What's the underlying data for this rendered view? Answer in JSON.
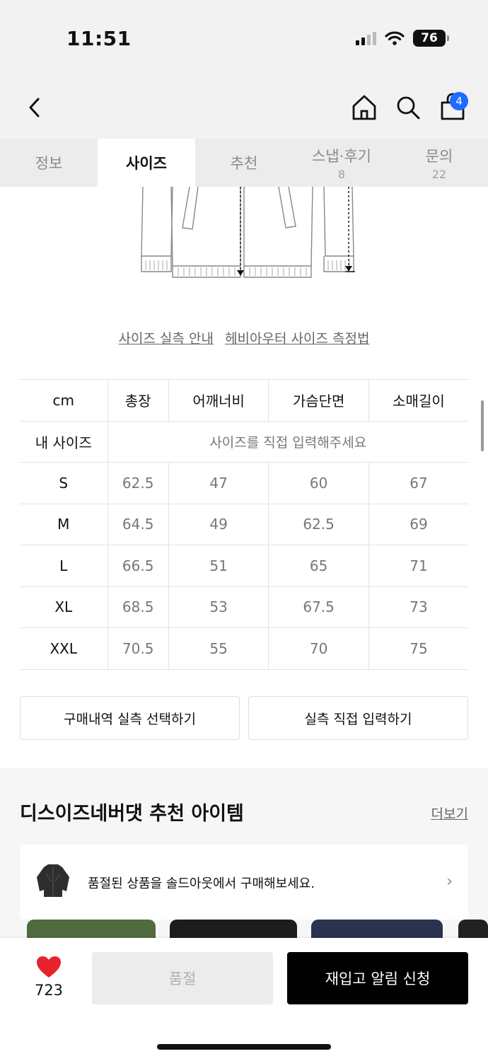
{
  "status": {
    "time": "11:51",
    "battery": "76"
  },
  "nav": {
    "cart_count": "4"
  },
  "tabs": [
    {
      "label": "정보",
      "sub": ""
    },
    {
      "label": "사이즈",
      "sub": ""
    },
    {
      "label": "추천",
      "sub": ""
    },
    {
      "label": "스냅·후기",
      "sub": "8"
    },
    {
      "label": "문의",
      "sub": "22"
    }
  ],
  "guides": {
    "actual_size": "사이즈 실측 안내",
    "heavy_outer": "헤비아우터 사이즈 측정법"
  },
  "size_table": {
    "headers": [
      "cm",
      "총장",
      "어깨너비",
      "가슴단면",
      "소매길이"
    ],
    "my_size_label": "내 사이즈",
    "my_size_hint": "사이즈를 직접 입력해주세요",
    "rows": [
      [
        "S",
        "62.5",
        "47",
        "60",
        "67"
      ],
      [
        "M",
        "64.5",
        "49",
        "62.5",
        "69"
      ],
      [
        "L",
        "66.5",
        "51",
        "65",
        "71"
      ],
      [
        "XL",
        "68.5",
        "53",
        "67.5",
        "73"
      ],
      [
        "XXL",
        "70.5",
        "55",
        "70",
        "75"
      ]
    ]
  },
  "actions": {
    "purchase_history": "구매내역 실측 선택하기",
    "manual_input": "실측 직접 입력하기"
  },
  "recommend": {
    "title": "디스이즈네버댓 추천 아이템",
    "more": "더보기",
    "soldout_notice": "품절된 상품을 솔드아웃에서 구매해보세요."
  },
  "bottom": {
    "like_count": "723",
    "soldout_label": "품절",
    "restock_label": "재입고 알림 신청"
  }
}
